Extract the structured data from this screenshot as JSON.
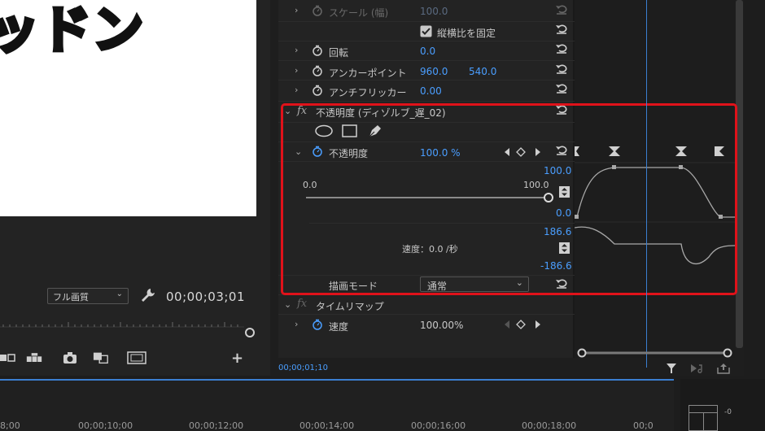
{
  "monitor": {
    "title_text": "ッドン",
    "quality": "フル画質",
    "timecode": "00;00;03;01"
  },
  "effects": {
    "scale_width": {
      "label": "スケール (幅)",
      "value": "100.0"
    },
    "uniform_scale": {
      "label": "縦横比を固定",
      "checked": true
    },
    "rotation": {
      "label": "回転",
      "value": "0.0"
    },
    "anchor": {
      "label": "アンカーポイント",
      "x": "960.0",
      "y": "540.0"
    },
    "antiflicker": {
      "label": "アンチフリッカー",
      "value": "0.00"
    },
    "opacity_section": {
      "label": "不透明度 (ディゾルブ_遅_02)"
    },
    "opacity": {
      "label": "不透明度",
      "value": "100.0 %"
    },
    "opacity_slider": {
      "min": "0.0",
      "max": "100.0",
      "fraction": 1.0
    },
    "velocity": {
      "label": "速度：0.0 /秒"
    },
    "blend_mode": {
      "label": "描画モード",
      "value": "通常"
    },
    "time_remap": {
      "label": "タイムリマップ"
    },
    "speed": {
      "label": "速度",
      "value": "100.00%"
    }
  },
  "graph": {
    "value_max": "100.0",
    "value_min": "0.0",
    "velocity_max": "186.6",
    "velocity_min": "-186.6"
  },
  "ec_timecode": "00;00;01;10",
  "timeline": {
    "ruler": [
      "8;00",
      "00;00;10;00",
      "00;00;12;00",
      "00;00;14;00",
      "00;00;16;00",
      "00;00;18;00",
      "00;0"
    ]
  },
  "colors": {
    "accent": "#4a9eff",
    "highlight": "#e0121a",
    "playhead": "#3b7fd1"
  }
}
